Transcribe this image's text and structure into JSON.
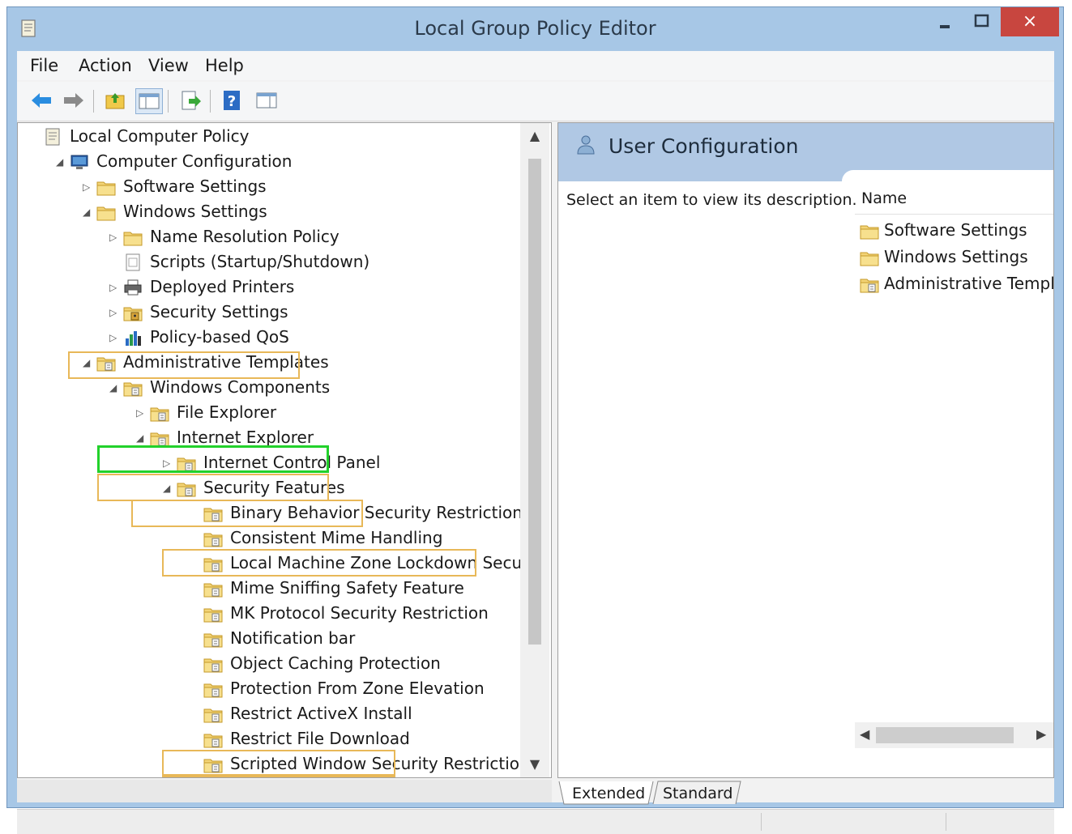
{
  "window": {
    "title": "Local Group Policy Editor",
    "close_glyph": "×"
  },
  "menu": [
    "File",
    "Action",
    "View",
    "Help"
  ],
  "tree": [
    {
      "label": "Local Computer Policy",
      "icon": "policy-doc-icon",
      "expander": ""
    },
    {
      "label": "Computer Configuration",
      "icon": "computer-icon",
      "expander": "expanded"
    },
    {
      "label": "Software Settings",
      "icon": "folder-icon",
      "expander": "collapsed"
    },
    {
      "label": "Windows Settings",
      "icon": "folder-icon",
      "expander": "expanded"
    },
    {
      "label": "Name Resolution Policy",
      "icon": "folder-icon",
      "expander": "collapsed"
    },
    {
      "label": "Scripts (Startup/Shutdown)",
      "icon": "script-icon",
      "expander": ""
    },
    {
      "label": "Deployed Printers",
      "icon": "printer-icon",
      "expander": "collapsed"
    },
    {
      "label": "Security Settings",
      "icon": "security-icon",
      "expander": "collapsed"
    },
    {
      "label": "Policy-based QoS",
      "icon": "qos-chart-icon",
      "expander": "collapsed"
    },
    {
      "label": "Administrative Templates",
      "icon": "admin-folder-icon",
      "expander": "expanded"
    },
    {
      "label": "Windows Components",
      "icon": "admin-folder-icon",
      "expander": "expanded"
    },
    {
      "label": "File Explorer",
      "icon": "admin-folder-icon",
      "expander": "collapsed"
    },
    {
      "label": "Internet Explorer",
      "icon": "admin-folder-icon",
      "expander": "expanded"
    },
    {
      "label": "Internet Control Panel",
      "icon": "admin-folder-icon",
      "expander": "collapsed"
    },
    {
      "label": "Security Features",
      "icon": "admin-folder-icon",
      "expander": "expanded"
    },
    {
      "label": "Binary Behavior Security Restriction",
      "icon": "admin-folder-icon",
      "expander": ""
    },
    {
      "label": "Consistent Mime Handling",
      "icon": "admin-folder-icon",
      "expander": ""
    },
    {
      "label": "Local Machine Zone Lockdown Security",
      "icon": "admin-folder-icon",
      "expander": ""
    },
    {
      "label": "Mime Sniffing Safety Feature",
      "icon": "admin-folder-icon",
      "expander": ""
    },
    {
      "label": "MK Protocol Security Restriction",
      "icon": "admin-folder-icon",
      "expander": ""
    },
    {
      "label": "Notification bar",
      "icon": "admin-folder-icon",
      "expander": ""
    },
    {
      "label": "Object Caching Protection",
      "icon": "admin-folder-icon",
      "expander": ""
    },
    {
      "label": "Protection From Zone Elevation",
      "icon": "admin-folder-icon",
      "expander": ""
    },
    {
      "label": "Restrict ActiveX Install",
      "icon": "admin-folder-icon",
      "expander": ""
    },
    {
      "label": "Restrict File Download",
      "icon": "admin-folder-icon",
      "expander": ""
    },
    {
      "label": "Scripted Window Security Restrictions",
      "icon": "admin-folder-icon",
      "expander": ""
    }
  ],
  "right": {
    "title": "User Configuration",
    "description": "Select an item to view its description.",
    "column_name": "Name",
    "items": [
      "Software Settings",
      "Windows Settings",
      "Administrative Template"
    ]
  },
  "tabs": [
    "Extended",
    "Standard"
  ],
  "colors": {
    "highlight": "#e8b858",
    "highlight_green": "#22d12b",
    "close_red": "#c8463f"
  }
}
